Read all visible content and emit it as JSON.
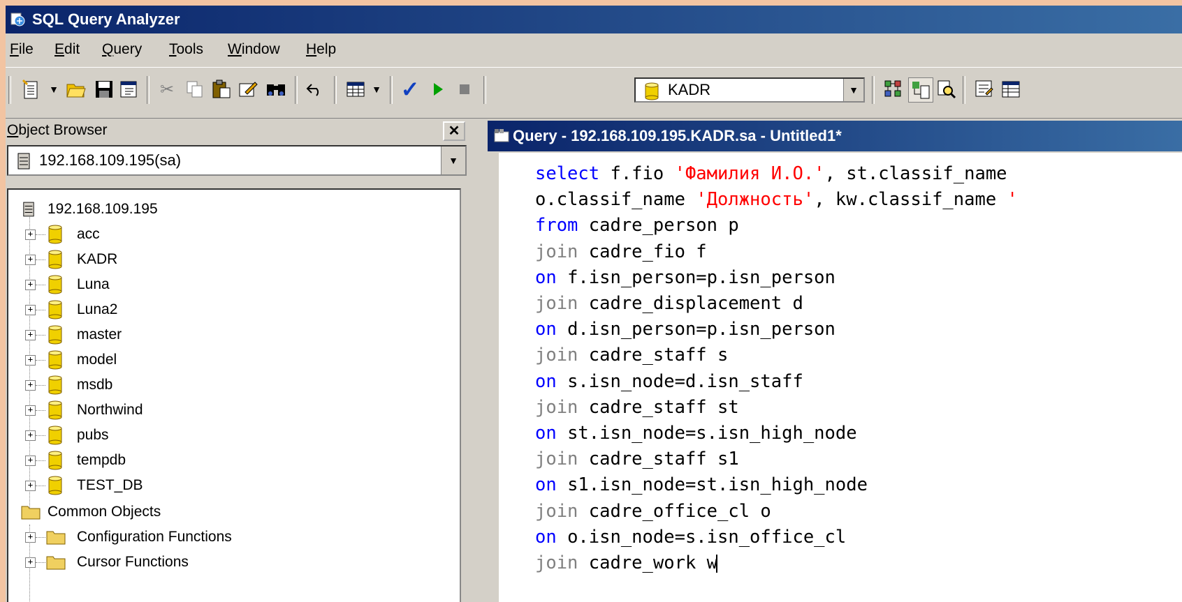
{
  "window": {
    "title": "SQL Query Analyzer",
    "icon": "query-analyzer-icon"
  },
  "menu": [
    "File",
    "Edit",
    "Query",
    "Tools",
    "Window",
    "Help"
  ],
  "toolbar": {
    "icons": [
      "new-query-icon",
      "open-folder-icon",
      "save-icon",
      "load-script-icon",
      "cut-icon",
      "copy-icon",
      "paste-icon",
      "edit-icon",
      "find-icon",
      "undo-icon",
      "results-grid-icon",
      "parse-query-icon",
      "execute-icon",
      "cancel-query-icon",
      "show-plan-icon",
      "object-browser-icon",
      "search-icon",
      "properties-icon",
      "results-pane-icon"
    ],
    "database": "KADR"
  },
  "object_browser": {
    "title": "Object Browser",
    "server_combo": "192.168.109.195(sa)",
    "server": "192.168.109.195",
    "databases": [
      "acc",
      "KADR",
      "Luna",
      "Luna2",
      "master",
      "model",
      "msdb",
      "Northwind",
      "pubs",
      "tempdb",
      "TEST_DB"
    ],
    "common": "Common Objects",
    "folders": [
      "Configuration Functions",
      "Cursor Functions"
    ]
  },
  "query_window": {
    "title": "Query - 192.168.109.195.KADR.sa - Untitled1*",
    "lines": [
      "select f.fio 'Фамилия И.О.', st.classif_name",
      "o.classif_name 'Должность', kw.classif_name '",
      "from cadre_person p",
      "join cadre_fio f",
      "on f.isn_person=p.isn_person",
      "join cadre_displacement d",
      "on d.isn_person=p.isn_person",
      "join cadre_staff s",
      "on s.isn_node=d.isn_staff",
      "join cadre_staff st",
      "on st.isn_node=s.isn_high_node",
      "join cadre_staff s1",
      "on s1.isn_node=st.isn_high_node",
      "join cadre_office_cl o",
      "on o.isn_node=s.isn_office_cl",
      "join cadre_work w"
    ]
  },
  "colors": {
    "keyword": "#0000ff",
    "string": "#ff0000",
    "join_keyword": "#808080",
    "titlebar": "#0a246a"
  }
}
